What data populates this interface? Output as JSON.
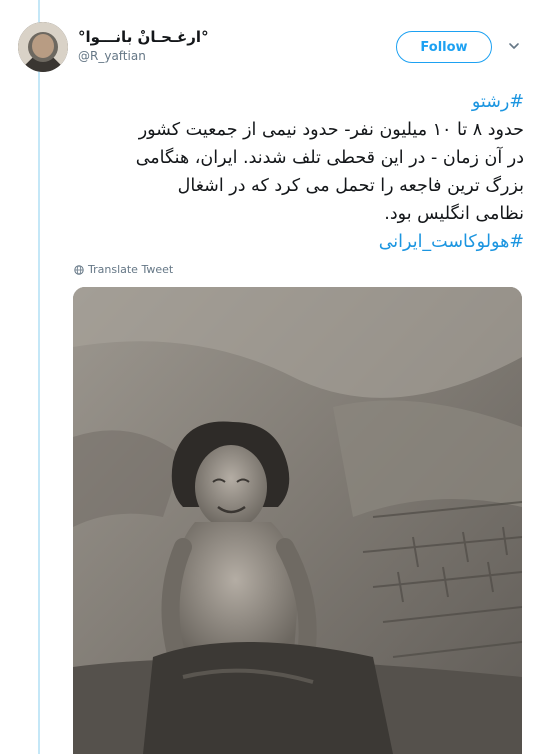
{
  "user": {
    "display_name": "°ارغـحـانْ بانـــوا°",
    "handle": "@R_yaftian"
  },
  "follow_button": {
    "label": "Follow"
  },
  "tweet": {
    "hashtag_1": "#رشتو",
    "line_1": "حدود ۸ تا ۱۰ میلیون نفر- حدود نیمی از جمعیت کشور",
    "line_2": "در آن زمان - در این قحطی تلف شدند. ایران، هنگامی",
    "line_3": "بزرگ ترین فاجعه را تحمل می کرد که در اشغال",
    "line_4": "نظامی انگلیس بود.",
    "hashtag_2": "#هولوکاست_ایرانی"
  },
  "translate_label": "Translate Tweet",
  "icons": {
    "chevron": "chevron-down-icon",
    "globe": "globe-icon"
  },
  "colors": {
    "accent": "#1da1f2",
    "hashtag": "#1b95e0",
    "thread_line": "#c4e7f7",
    "secondary_text": "#657786"
  }
}
